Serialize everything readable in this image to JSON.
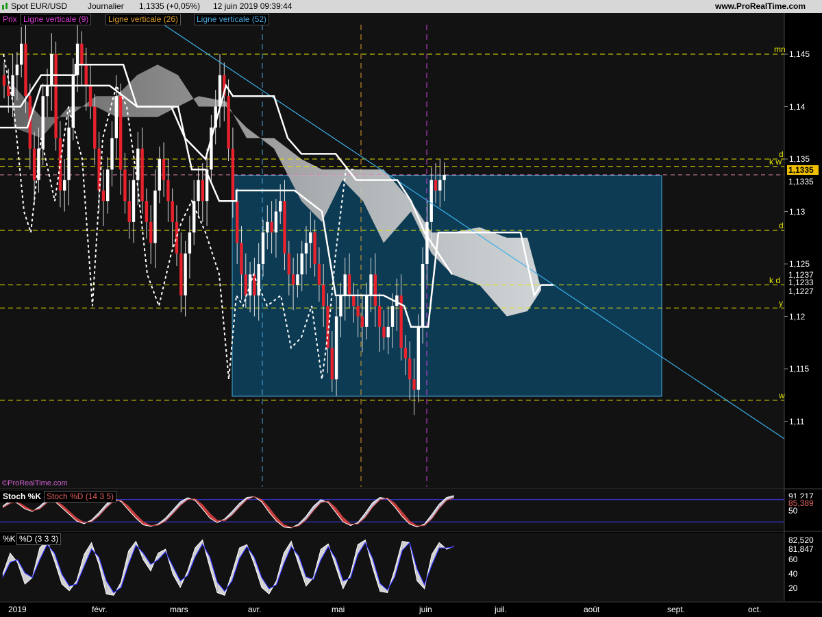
{
  "header": {
    "instrument": "Spot EUR/USD",
    "period": "Journalier",
    "quote": "1,1335 (+0,05%)",
    "datetime": "12 juin 2019 09:39:44",
    "site": "www.ProRealTime.com"
  },
  "legend": {
    "prix": "Prix",
    "v9": "Ligne verticale (9)",
    "v26": "Ligne verticale (26)",
    "v52": "Ligne verticale (52)"
  },
  "watermark": "©ProRealTime.com",
  "colors": {
    "bull": "#ffffff",
    "bear": "#e8222d",
    "trendline": "#3ab0e8",
    "level": "#e6e600",
    "box_fill": "#0c4a6a",
    "box_stroke": "#4aa8d8",
    "vline9": "#d040e0",
    "vline26": "#e0a030",
    "vline52": "#4aa8e0",
    "cloud_bear": "#8c8c8c",
    "cloud_bull": "#e0e0e0"
  },
  "price_axis": {
    "ticks": [
      "1,145",
      "1,14",
      "1,135",
      "1,13",
      "1,125",
      "1,12",
      "1,115",
      "1,11"
    ],
    "current_price": "1,1335",
    "current_price2": "1,1335",
    "ichimoku_values": [
      "1,1237",
      "1,1233",
      "1,1227"
    ]
  },
  "levels": [
    {
      "label": "mn",
      "value": 1.145
    },
    {
      "label": "d",
      "value": 1.135
    },
    {
      "label": "k w",
      "value": 1.1343
    },
    {
      "label": "d",
      "value": 1.1282
    },
    {
      "label": "k d",
      "value": 1.123
    },
    {
      "label": "y",
      "value": 1.1208
    },
    {
      "label": "w",
      "value": 1.112
    }
  ],
  "months": [
    "2019",
    "févr.",
    "mars",
    "avr.",
    "mai",
    "juin",
    "juil.",
    "août",
    "sept.",
    "oct."
  ],
  "stoch1": {
    "label_k": "Stoch %K",
    "label_d": "Stoch %D (14 3 5)",
    "value_k": "91,217",
    "value_d": "85,389",
    "tick": "50"
  },
  "stoch2": {
    "label_k": "%K",
    "label_d": "%D (3 3 3)",
    "value_k": "82,520",
    "value_d": "81,847",
    "ticks": [
      "60",
      "40",
      "20"
    ]
  },
  "chart_data": [
    {
      "type": "candlestick",
      "title": "Spot EUR/USD",
      "ylim": [
        1.1045,
        1.148
      ],
      "notes": "Daily candles with Ichimoku cloud, dashed lagging span, trendline, and a shaded rectangle; values estimated from the screenshot",
      "close_path": [
        1.142,
        1.141,
        1.143,
        1.144,
        1.146,
        1.141,
        1.136,
        1.133,
        1.136,
        1.141,
        1.142,
        1.145,
        1.137,
        1.132,
        1.133,
        1.138,
        1.143,
        1.146,
        1.144,
        1.142,
        1.14,
        1.136,
        1.132,
        1.131,
        1.134,
        1.137,
        1.141,
        1.134,
        1.131,
        1.129,
        1.133,
        1.136,
        1.131,
        1.129,
        1.127,
        1.132,
        1.135,
        1.133,
        1.131,
        1.129,
        1.126,
        1.122,
        1.126,
        1.128,
        1.131,
        1.133,
        1.131,
        1.134,
        1.138,
        1.14,
        1.143,
        1.141,
        1.136,
        1.131,
        1.127,
        1.124,
        1.122,
        1.124,
        1.122,
        1.125,
        1.128,
        1.129,
        1.128,
        1.13,
        1.131,
        1.126,
        1.124,
        1.123,
        1.124,
        1.126,
        1.127,
        1.128,
        1.125,
        1.123,
        1.121,
        1.117,
        1.114,
        1.12,
        1.122,
        1.124,
        1.122,
        1.121,
        1.12,
        1.119,
        1.122,
        1.124,
        1.121,
        1.119,
        1.118,
        1.119,
        1.121,
        1.122,
        1.117,
        1.116,
        1.114,
        1.113,
        1.119,
        1.125,
        1.129,
        1.133,
        1.132,
        1.133,
        1.1335
      ]
    },
    {
      "type": "area",
      "title": "Stoch %K / Stoch %D (14 3 5)",
      "ylim": [
        0,
        100
      ],
      "series": [
        {
          "name": "Stoch %K",
          "values": [
            62,
            78,
            70,
            55,
            48,
            62,
            80,
            76,
            58,
            40,
            22,
            15,
            25,
            45,
            68,
            82,
            75,
            52,
            30,
            12,
            8,
            14,
            30,
            52,
            74,
            85,
            78,
            55,
            30,
            18,
            28,
            48,
            70,
            86,
            88,
            74,
            46,
            22,
            6,
            4,
            14,
            35,
            62,
            80,
            72,
            46,
            20,
            10,
            18,
            44,
            72,
            86,
            82,
            60,
            34,
            14,
            6,
            14,
            40,
            68,
            86,
            91
          ]
        },
        {
          "name": "Stoch %D",
          "values": [
            58,
            70,
            74,
            62,
            50,
            55,
            72,
            78,
            66,
            48,
            30,
            18,
            20,
            36,
            58,
            76,
            78,
            62,
            40,
            20,
            10,
            11,
            22,
            42,
            64,
            80,
            82,
            66,
            42,
            24,
            23,
            38,
            60,
            80,
            88,
            80,
            58,
            32,
            12,
            5,
            9,
            25,
            50,
            72,
            76,
            58,
            32,
            14,
            14,
            32,
            60,
            80,
            84,
            70,
            46,
            22,
            9,
            10,
            28,
            56,
            78,
            85
          ]
        }
      ]
    },
    {
      "type": "area",
      "title": "%K / %D (3 3 3)",
      "ylim": [
        0,
        100
      ],
      "series": [
        {
          "name": "%K",
          "values": [
            40,
            72,
            58,
            25,
            35,
            80,
            92,
            60,
            25,
            15,
            30,
            70,
            88,
            55,
            10,
            8,
            28,
            75,
            90,
            62,
            45,
            72,
            78,
            40,
            20,
            45,
            80,
            92,
            50,
            12,
            8,
            42,
            80,
            85,
            55,
            20,
            10,
            30,
            72,
            90,
            55,
            22,
            35,
            78,
            86,
            52,
            18,
            40,
            85,
            92,
            50,
            14,
            12,
            48,
            90,
            88,
            30,
            18,
            70,
            88,
            78,
            82.5
          ]
        },
        {
          "name": "%D",
          "values": [
            35,
            58,
            62,
            42,
            35,
            62,
            85,
            72,
            40,
            22,
            25,
            52,
            78,
            66,
            30,
            12,
            20,
            55,
            84,
            72,
            55,
            62,
            74,
            52,
            30,
            38,
            66,
            86,
            66,
            28,
            14,
            30,
            64,
            82,
            66,
            35,
            18,
            24,
            56,
            82,
            68,
            36,
            32,
            62,
            82,
            64,
            30,
            34,
            70,
            88,
            64,
            26,
            16,
            36,
            76,
            88,
            48,
            24,
            54,
            80,
            80,
            81.8
          ]
        }
      ]
    }
  ]
}
